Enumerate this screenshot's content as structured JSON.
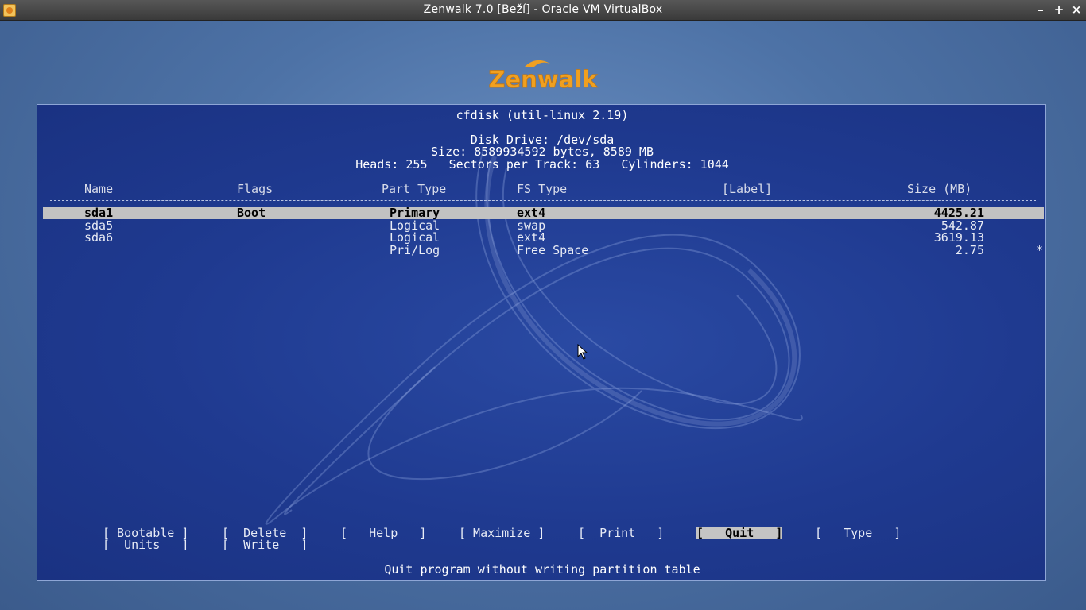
{
  "window": {
    "title": "Zenwalk 7.0 [Beží] - Oracle VM VirtualBox",
    "controls": {
      "minimize": "–",
      "maximize": "+",
      "close": "×"
    }
  },
  "logo": {
    "text": "Zenwalk",
    "color": "#f0a020"
  },
  "cfdisk": {
    "program": "cfdisk (util-linux 2.19)",
    "disk_drive": "Disk Drive: /dev/sda",
    "size_line": "Size: 8589934592 bytes, 8589 MB",
    "geometry": "Heads: 255   Sectors per Track: 63   Cylinders: 1044",
    "columns": {
      "name": "Name",
      "flags": "Flags",
      "part_type": "Part Type",
      "fs_type": "FS Type",
      "label": "[Label]",
      "size": "Size (MB)"
    },
    "rows": [
      {
        "name": "sda1",
        "flags": "Boot",
        "part_type": "Primary",
        "fs_type": "ext4",
        "label": "",
        "size": "4425.21",
        "marker": ""
      },
      {
        "name": "sda5",
        "flags": "",
        "part_type": "Logical",
        "fs_type": "swap",
        "label": "",
        "size": "542.87",
        "marker": ""
      },
      {
        "name": "sda6",
        "flags": "",
        "part_type": "Logical",
        "fs_type": "ext4",
        "label": "",
        "size": "3619.13",
        "marker": ""
      },
      {
        "name": "",
        "flags": "",
        "part_type": "Pri/Log",
        "fs_type": "Free Space",
        "label": "",
        "size": "2.75",
        "marker": "*"
      }
    ],
    "selected_row": 0,
    "menu": {
      "bootable": "[ Bootable ]",
      "delete": "[  Delete  ]",
      "help": "[   Help   ]",
      "maximize": "[ Maximize ]",
      "print": "[  Print   ]",
      "quit": "[   Quit   ]",
      "type": "[   Type   ]",
      "units": "[  Units   ]",
      "write": "[  Write   ]"
    },
    "active_menu": "quit",
    "status": "Quit program without writing partition table"
  },
  "colors": {
    "console_bg": "#1f3a90",
    "highlight": "#c2c2c2",
    "titlebar": "#4a4a4a"
  }
}
